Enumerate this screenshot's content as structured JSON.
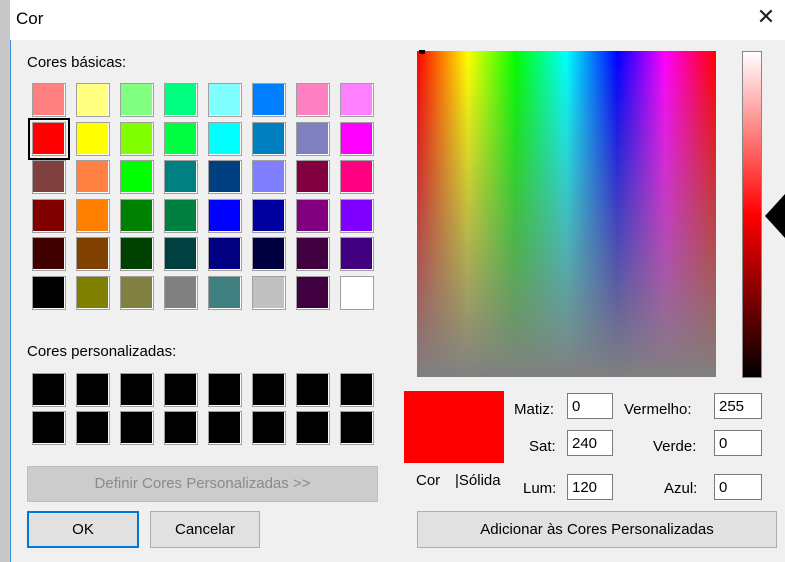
{
  "window": {
    "title": "Cor",
    "close_symbol": "✕"
  },
  "basic": {
    "label": "Cores básicas:",
    "rows": [
      [
        "#ff8080",
        "#ffff80",
        "#80ff80",
        "#00ff80",
        "#80ffff",
        "#0080ff",
        "#ff80c0",
        "#ff80ff"
      ],
      [
        "#ff0000",
        "#ffff00",
        "#80ff00",
        "#00ff40",
        "#00ffff",
        "#0080c0",
        "#8080c0",
        "#ff00ff"
      ],
      [
        "#804040",
        "#ff8040",
        "#00ff00",
        "#008080",
        "#004080",
        "#8080ff",
        "#800040",
        "#ff0080"
      ],
      [
        "#800000",
        "#ff8000",
        "#008000",
        "#008040",
        "#0000ff",
        "#0000a0",
        "#800080",
        "#8000ff"
      ],
      [
        "#400000",
        "#804000",
        "#004000",
        "#004040",
        "#000080",
        "#000040",
        "#400040",
        "#400080"
      ],
      [
        "#000000",
        "#808000",
        "#808040",
        "#808080",
        "#408080",
        "#c0c0c0",
        "#400040",
        "#ffffff"
      ]
    ],
    "selected": [
      1,
      0
    ]
  },
  "custom": {
    "label": "Cores personalizadas:",
    "colors": [
      "#000000",
      "#000000",
      "#000000",
      "#000000",
      "#000000",
      "#000000",
      "#000000",
      "#000000",
      "#000000",
      "#000000",
      "#000000",
      "#000000",
      "#000000",
      "#000000",
      "#000000",
      "#000000"
    ]
  },
  "buttons": {
    "define_custom": "Definir Cores Personalizadas >>",
    "ok": "OK",
    "cancel": "Cancelar",
    "add_custom": "Adicionar às Cores Personalizadas"
  },
  "preview": {
    "color": "#ff0000",
    "label_cor": "Cor",
    "label_solida": "|Sólida"
  },
  "fields": {
    "matiz": {
      "label": "Matiz:",
      "value": "0"
    },
    "sat": {
      "label": "Sat:",
      "value": "240"
    },
    "lum": {
      "label": "Lum:",
      "value": "120"
    },
    "vermelho": {
      "label": "Vermelho:",
      "value": "255"
    },
    "verde": {
      "label": "Verde:",
      "value": "0"
    },
    "azul": {
      "label": "Azul:",
      "value": "0"
    }
  }
}
